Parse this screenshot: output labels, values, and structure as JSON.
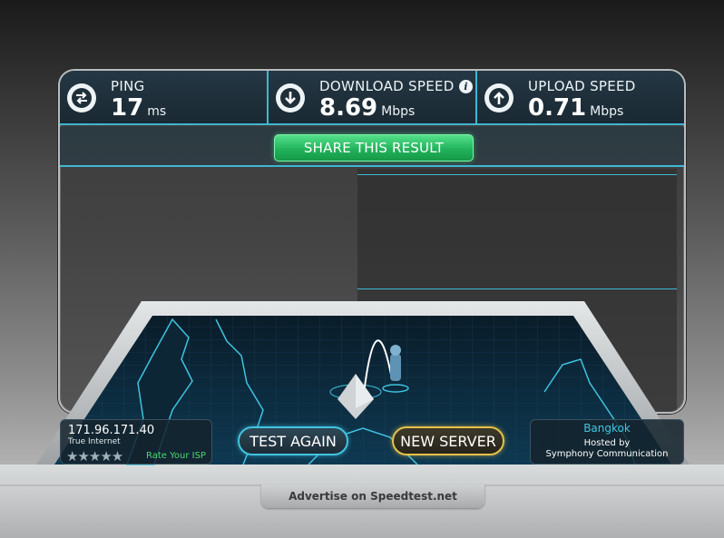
{
  "stats": {
    "ping": {
      "label": "PING",
      "value": "17",
      "unit": "ms",
      "icon": "ping-arrows-icon"
    },
    "download": {
      "label": "DOWNLOAD SPEED",
      "value": "8.69",
      "unit": "Mbps",
      "icon": "download-arrow-icon",
      "info": "i"
    },
    "upload": {
      "label": "UPLOAD SPEED",
      "value": "0.71",
      "unit": "Mbps",
      "icon": "upload-arrow-icon"
    }
  },
  "share_label": "SHARE THIS RESULT",
  "client": {
    "ip": "171.96.171.40",
    "isp": "True Internet",
    "stars": "★★★★★",
    "rate_label": "Rate Your ISP"
  },
  "buttons": {
    "test_again": "TEST AGAIN",
    "new_server": "NEW SERVER"
  },
  "server": {
    "city": "Bangkok",
    "hosted_by": "Hosted by",
    "host": "Symphony Communication"
  },
  "advertise": "Advertise on Speedtest.net",
  "colors": {
    "accent": "#3fb7d4",
    "share_green": "#22b35c",
    "new_server_gold": "#e6c24a",
    "rate_green": "#4bd96e"
  }
}
